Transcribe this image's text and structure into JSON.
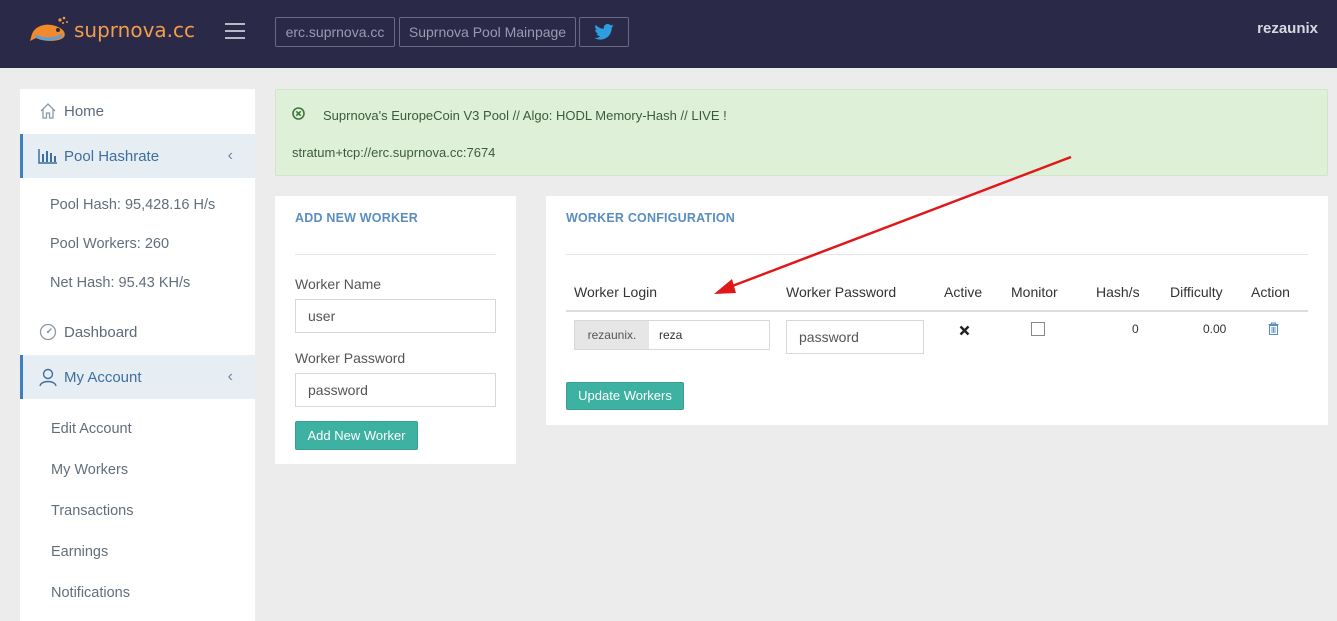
{
  "header": {
    "logo_text": "suprnova.cc",
    "buttons": [
      "erc.suprnova.cc",
      "Suprnova Pool Mainpage"
    ],
    "twitter_icon": "twitter-icon",
    "username": "rezaunix",
    "colors": {
      "bar": "#2a2a48",
      "logo": "#f39c4a"
    }
  },
  "sidebar": {
    "home": "Home",
    "pool_hashrate": "Pool Hashrate",
    "pool_stats": [
      "Pool Hash: 95,428.16 H/s",
      "Pool Workers: 260",
      "Net Hash: 95.43 KH/s"
    ],
    "dashboard": "Dashboard",
    "my_account": "My Account",
    "account_items": [
      "Edit Account",
      "My Workers",
      "Transactions",
      "Earnings",
      "Notifications"
    ]
  },
  "alert": {
    "title": "Suprnova's EuropeCoin V3 Pool // Algo: HODL Memory-Hash // LIVE !",
    "stratum": "stratum+tcp://erc.suprnova.cc:7674",
    "icon": "close-circle-icon",
    "color": "#dff0d8"
  },
  "add_worker": {
    "title": "ADD NEW WORKER",
    "name_label": "Worker Name",
    "name_value": "user",
    "password_label": "Worker Password",
    "password_value": "password",
    "button": "Add New Worker"
  },
  "worker_config": {
    "title": "WORKER CONFIGURATION",
    "columns": [
      "Worker Login",
      "Worker Password",
      "Active",
      "Monitor",
      "Hash/s",
      "Difficulty",
      "Action"
    ],
    "rows": [
      {
        "login_prefix": "rezaunix.",
        "login_value": "reza",
        "password": "password",
        "active_icon": "x-mark-icon",
        "monitor_checked": false,
        "hashrate": "0",
        "difficulty": "0.00",
        "action_icon": "trash-icon"
      }
    ],
    "update_button": "Update Workers",
    "accent": "#3db1a2"
  }
}
